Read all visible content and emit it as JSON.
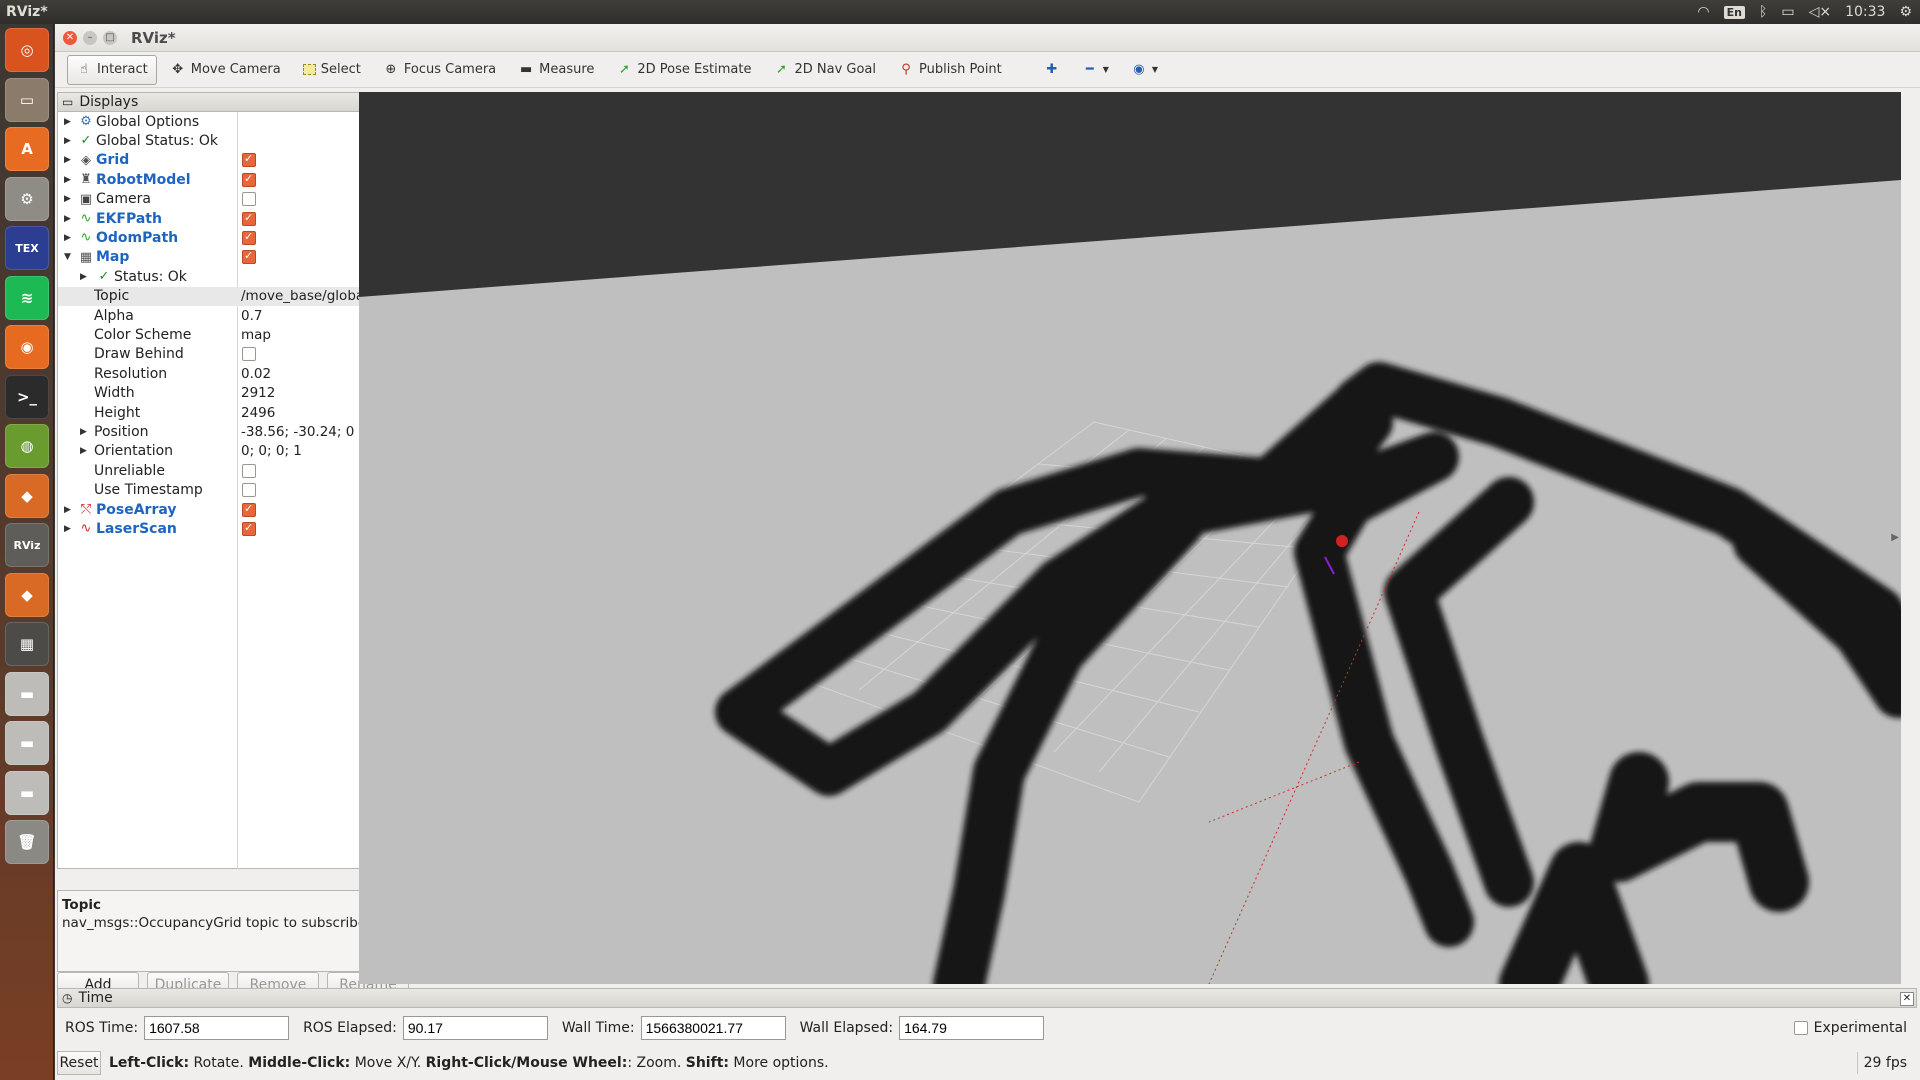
{
  "top_panel": {
    "app_title": "RViz*",
    "keyboard_layout": "En",
    "clock": "10:33"
  },
  "launcher": {
    "items": [
      {
        "name": "ubuntu-dash-icon",
        "color": "#d9531e",
        "glyph": "◎"
      },
      {
        "name": "files-icon",
        "color": "#8a7b6b",
        "glyph": "▭"
      },
      {
        "name": "software-center-icon",
        "color": "#e86b22",
        "glyph": "A"
      },
      {
        "name": "system-settings-icon",
        "color": "#8f8c86",
        "glyph": "⚙"
      },
      {
        "name": "texstudio-icon",
        "color": "#2c3e91",
        "glyph": "TEX"
      },
      {
        "name": "spotify-icon",
        "color": "#1db954",
        "glyph": "≋"
      },
      {
        "name": "firefox-icon",
        "color": "#e66a1f",
        "glyph": "◉"
      },
      {
        "name": "terminal-icon",
        "color": "#2b2b2b",
        "glyph": ">_"
      },
      {
        "name": "image-viewer-icon",
        "color": "#6a9b2e",
        "glyph": "◍"
      },
      {
        "name": "box-app-icon",
        "color": "#d86a25",
        "glyph": "◆"
      },
      {
        "name": "rviz-icon",
        "color": "#5e5d59",
        "glyph": "RViz"
      },
      {
        "name": "box-app-2-icon",
        "color": "#d86a25",
        "glyph": "◆"
      },
      {
        "name": "workspace-switcher-icon",
        "color": "#4c4b47",
        "glyph": "▦"
      },
      {
        "name": "drive-1-icon",
        "color": "#bdbcb8",
        "glyph": "▬"
      },
      {
        "name": "drive-2-icon",
        "color": "#bdbcb8",
        "glyph": "▬"
      },
      {
        "name": "drive-3-icon",
        "color": "#bdbcb8",
        "glyph": "▬"
      },
      {
        "name": "trash-icon",
        "color": "#8a8984",
        "glyph": "🗑"
      }
    ]
  },
  "window": {
    "title": "RViz*"
  },
  "toolbar": {
    "interact": "Interact",
    "move_camera": "Move Camera",
    "select": "Select",
    "focus_camera": "Focus Camera",
    "measure": "Measure",
    "pose_estimate": "2D Pose Estimate",
    "nav_goal": "2D Nav Goal",
    "publish_point": "Publish Point"
  },
  "displays": {
    "title": "Displays",
    "rows": [
      {
        "label": "Global Options",
        "style": "plain",
        "icon": "⚙",
        "icon_color": "#3f6fb5"
      },
      {
        "label": "Global Status: Ok",
        "style": "plain",
        "icon": "✓",
        "icon_color": "#1e8a2a"
      },
      {
        "label": "Grid",
        "style": "blue",
        "icon": "◈",
        "icon_color": "#555",
        "checked": true
      },
      {
        "label": "RobotModel",
        "style": "blue",
        "icon": "♜",
        "icon_color": "#555",
        "checked": true
      },
      {
        "label": "Camera",
        "style": "plain",
        "icon": "▣",
        "icon_color": "#444",
        "checked": false
      },
      {
        "label": "EKFPath",
        "style": "blue",
        "icon": "∿",
        "icon_color": "#2aa52a",
        "checked": true
      },
      {
        "label": "OdomPath",
        "style": "blue",
        "icon": "∿",
        "icon_color": "#2aa52a",
        "checked": true
      },
      {
        "label": "Map",
        "style": "blue",
        "icon": "▦",
        "icon_color": "#555",
        "checked": true
      },
      {
        "label": "Status: Ok",
        "style": "plain",
        "icon": "✓",
        "icon_color": "#1e8a2a"
      },
      {
        "label": "Topic",
        "style": "prop",
        "value": "/move_base/global_co..."
      },
      {
        "label": "Alpha",
        "style": "prop",
        "value": "0.7"
      },
      {
        "label": "Color Scheme",
        "style": "prop",
        "value": "map"
      },
      {
        "label": "Draw Behind",
        "style": "prop",
        "checked": false
      },
      {
        "label": "Resolution",
        "style": "prop",
        "value": "0.02"
      },
      {
        "label": "Width",
        "style": "prop",
        "value": "2912"
      },
      {
        "label": "Height",
        "style": "prop",
        "value": "2496"
      },
      {
        "label": "Position",
        "style": "prop",
        "value": "-38.56; -30.24; 0"
      },
      {
        "label": "Orientation",
        "style": "prop",
        "value": "0; 0; 0; 1"
      },
      {
        "label": "Unreliable",
        "style": "prop",
        "checked": false
      },
      {
        "label": "Use Timestamp",
        "style": "prop",
        "checked": false
      },
      {
        "label": "PoseArray",
        "style": "blue",
        "icon": "⤲",
        "icon_color": "#d32222",
        "checked": true
      },
      {
        "label": "LaserScan",
        "style": "blue",
        "icon": "∿",
        "icon_color": "#d32222",
        "checked": true
      }
    ],
    "description_title": "Topic",
    "description_text": "nav_msgs::OccupancyGrid topic to subscribe to.",
    "buttons": {
      "add": "Add",
      "duplicate": "Duplicate",
      "remove": "Remove",
      "rename": "Rename"
    }
  },
  "time_panel": {
    "title": "Time",
    "ros_time_label": "ROS Time:",
    "ros_time": "1607.58",
    "ros_elapsed_label": "ROS Elapsed:",
    "ros_elapsed": "90.17",
    "wall_time_label": "Wall Time:",
    "wall_time": "1566380021.77",
    "wall_elapsed_label": "Wall Elapsed:",
    "wall_elapsed": "164.79",
    "experimental_label": "Experimental"
  },
  "status_bar": {
    "reset": "Reset",
    "left_click_key": "Left-Click:",
    "left_click_text": " Rotate. ",
    "middle_click_key": "Middle-Click:",
    "middle_click_text": " Move X/Y. ",
    "right_click_key": "Right-Click/Mouse Wheel:",
    "right_click_text": ": Zoom. ",
    "shift_key": "Shift:",
    "shift_text": " More options.",
    "fps": "29 fps"
  },
  "colors": {
    "accent_checkbox": "#e9663a",
    "display_blue": "#1f64c0",
    "map_free": "#bfbfbf",
    "map_obstacle": "#1a1a1a"
  }
}
